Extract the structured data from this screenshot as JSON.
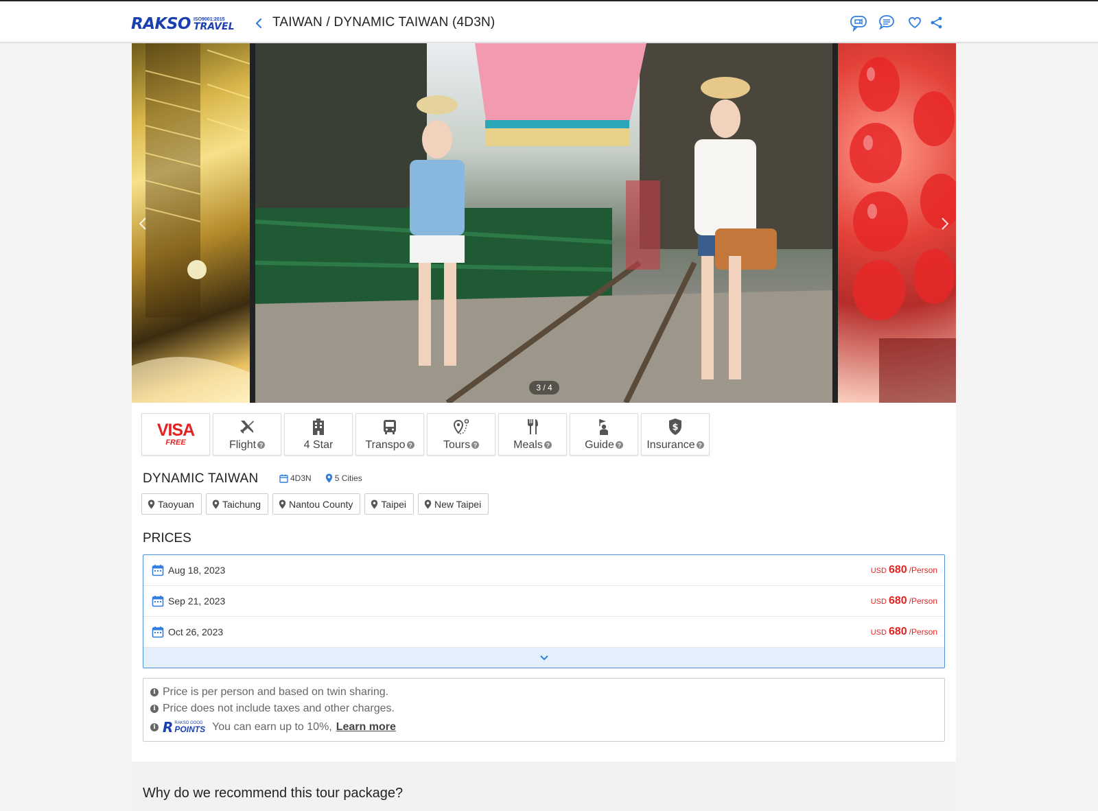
{
  "header": {
    "logo_main": "RAKSO",
    "logo_iso": "ISO9001:2015",
    "logo_travel": "TRAVEL",
    "title": "TAIWAN / DYNAMIC TAIWAN (4D3N)",
    "icons": [
      "video-chat-icon",
      "chat-icon",
      "heart-icon",
      "share-icon"
    ]
  },
  "gallery": {
    "counter": "3 / 4"
  },
  "features": [
    {
      "name": "visa",
      "word": "VISA",
      "sub": "FREE",
      "help": false
    },
    {
      "name": "flight",
      "label": "Flight",
      "help": true
    },
    {
      "name": "hotel",
      "label": "4 Star",
      "help": false
    },
    {
      "name": "transport",
      "label": "Transpo",
      "help": true
    },
    {
      "name": "tours",
      "label": "Tours",
      "help": true
    },
    {
      "name": "meals",
      "label": "Meals",
      "help": true
    },
    {
      "name": "guide",
      "label": "Guide",
      "help": true
    },
    {
      "name": "insurance",
      "label": "Insurance",
      "help": true
    }
  ],
  "tour": {
    "name": "DYNAMIC TAIWAN",
    "duration": "4D3N",
    "cities_count": "5 Cities",
    "cities": [
      "Taoyuan",
      "Taichung",
      "Nantou County",
      "Taipei",
      "New Taipei"
    ]
  },
  "prices": {
    "title": "PRICES",
    "rows": [
      {
        "date": "Aug 18, 2023",
        "currency": "USD",
        "amount": "680",
        "unit": "/Person"
      },
      {
        "date": "Sep 21, 2023",
        "currency": "USD",
        "amount": "680",
        "unit": "/Person"
      },
      {
        "date": "Oct 26, 2023",
        "currency": "USD",
        "amount": "680",
        "unit": "/Person"
      }
    ]
  },
  "notes": {
    "line1": "Price is per person and based on twin sharing.",
    "line2": "Price does not include taxes and other charges.",
    "points_logo_r": "R",
    "points_logo_small": "RAKSO GOOD",
    "points_logo_word": "POINTS",
    "line3": "You can earn up to 10%,",
    "learn_more": "Learn more"
  },
  "recommend": {
    "title": "Why do we recommend this tour package?"
  },
  "colors": {
    "brand_blue": "#1a3fb0",
    "accent_blue": "#4a90d9",
    "price_red": "#e32222"
  }
}
